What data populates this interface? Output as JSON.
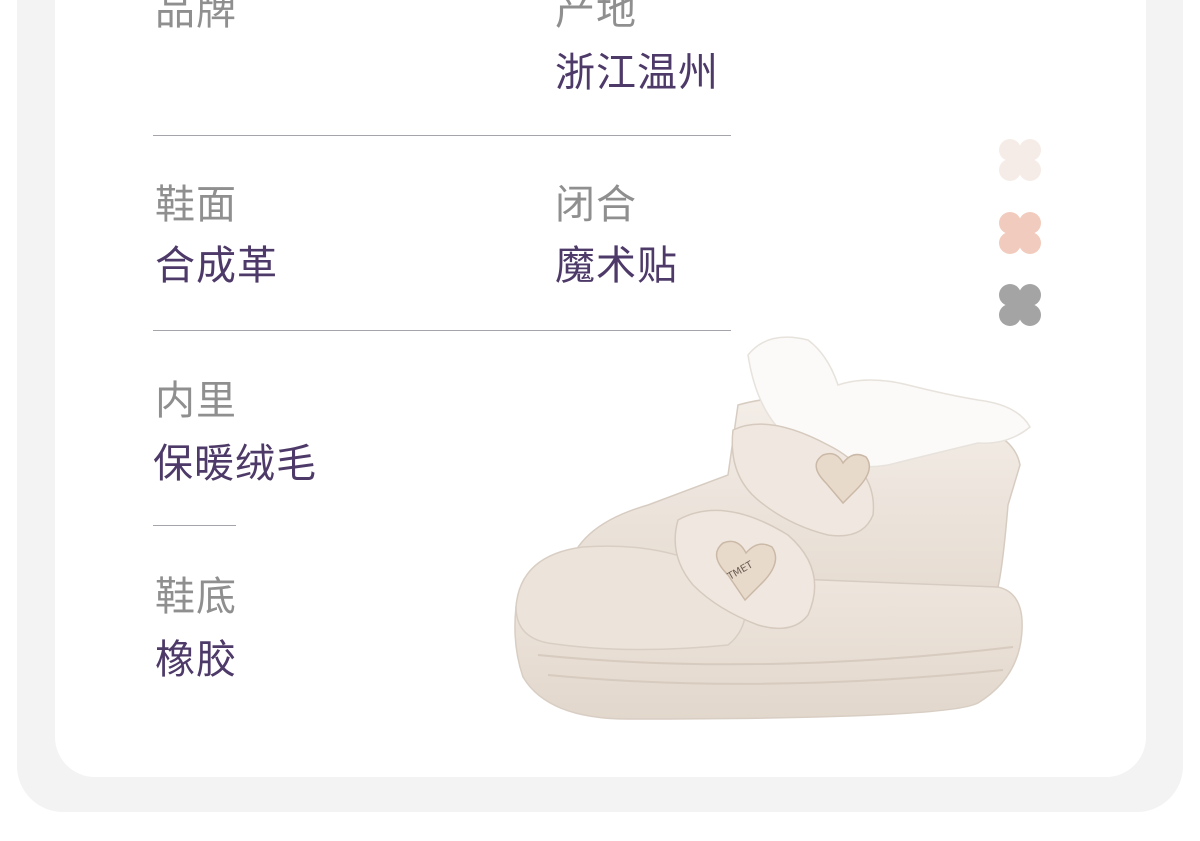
{
  "specs": {
    "brand_label": "品牌",
    "origin_label": "产地",
    "origin_value": "浙江温州",
    "upper_label": "鞋面",
    "upper_value": "合成革",
    "closure_label": "闭合",
    "closure_value": "魔术贴",
    "lining_label": "内里",
    "lining_value": "保暖绒毛",
    "sole_label": "鞋底",
    "sole_value": "橡胶"
  },
  "product": {
    "badge_text": "TMET"
  },
  "swatches": [
    {
      "name": "cream",
      "color": "#f6ece7"
    },
    {
      "name": "pink",
      "color": "#f1cbbd"
    },
    {
      "name": "gray",
      "color": "#a4a4a4"
    }
  ]
}
